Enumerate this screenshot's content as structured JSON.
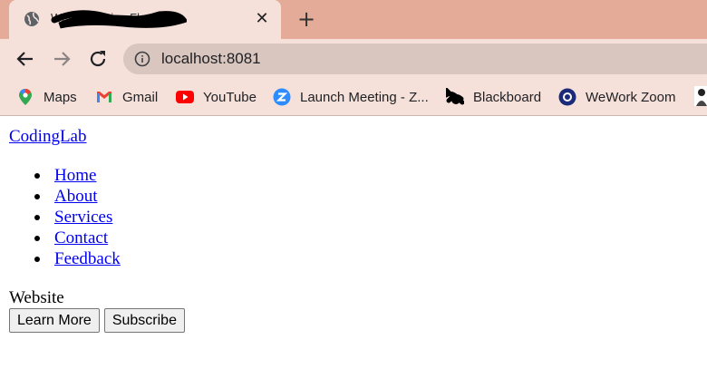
{
  "browser": {
    "tab": {
      "title": "Website Using Flask",
      "close_glyph": "✕"
    },
    "new_tab_glyph": "+",
    "address": {
      "url": "localhost:8081"
    },
    "bookmarks": [
      {
        "label": "Maps",
        "icon": "maps-pin-icon"
      },
      {
        "label": "Gmail",
        "icon": "gmail-icon"
      },
      {
        "label": "YouTube",
        "icon": "youtube-icon"
      },
      {
        "label": "Launch Meeting - Z...",
        "icon": "zoom-icon"
      },
      {
        "label": "Blackboard",
        "icon": "blackboard-icon"
      },
      {
        "label": "WeWork Zoom",
        "icon": "wework-icon"
      }
    ]
  },
  "page": {
    "logo": "CodingLab",
    "nav": [
      "Home",
      "About",
      "Services",
      "Contact",
      "Feedback"
    ],
    "text": "Website",
    "buttons": {
      "learn_more": "Learn More",
      "subscribe": "Subscribe"
    }
  }
}
